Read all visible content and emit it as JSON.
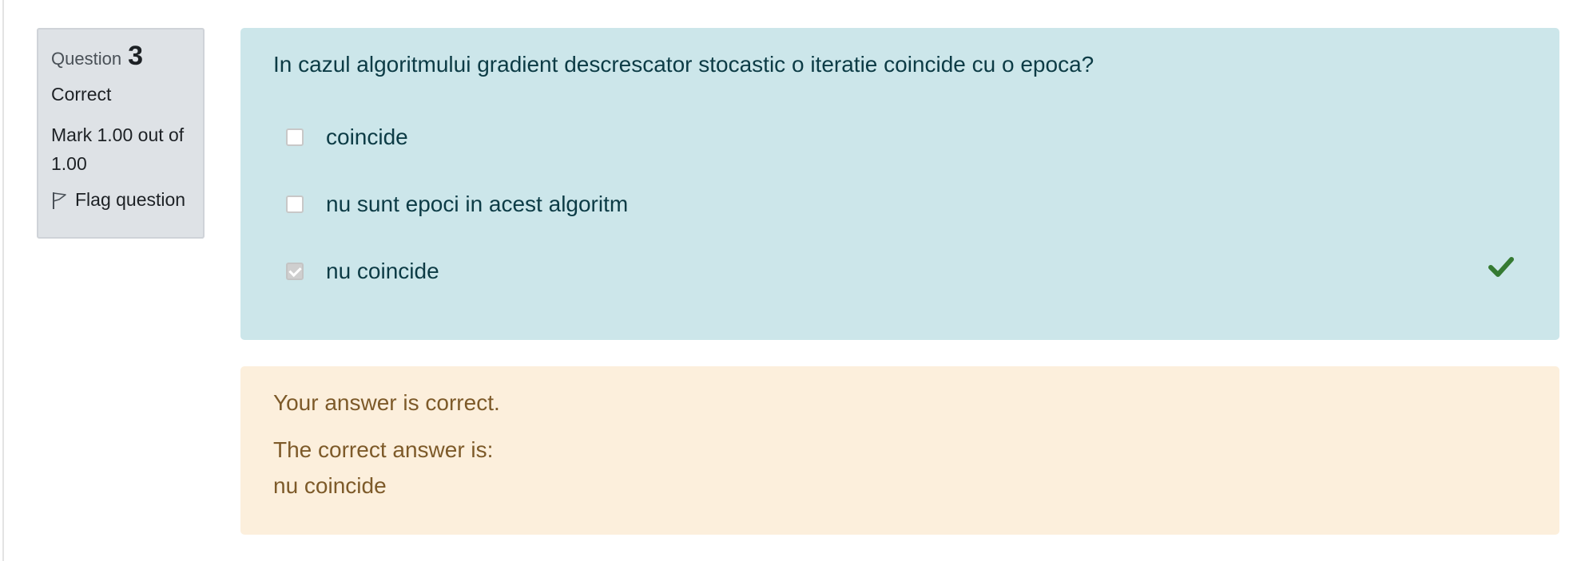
{
  "info": {
    "question_label": "Question",
    "question_number": "3",
    "state": "Correct",
    "grade": "Mark 1.00 out of 1.00",
    "flag_label": "Flag question"
  },
  "question": {
    "text": "In cazul algoritmului gradient descrescator stocastic o iteratie coincide cu o epoca?",
    "answers": [
      {
        "label": "coincide",
        "checked": false
      },
      {
        "label": "nu sunt epoci in acest algoritm",
        "checked": false
      },
      {
        "label": "nu coincide",
        "checked": true
      }
    ],
    "correct_mark_color": "#357a32"
  },
  "feedback": {
    "general": "Your answer is correct.",
    "right_answer_label": "The correct answer is:",
    "right_answer_value": "nu coincide"
  },
  "colors": {
    "info_bg": "#dee2e6",
    "formulation_bg": "#cce6ea",
    "feedback_bg": "#fcefdc",
    "feedback_text": "#7d5a29"
  }
}
